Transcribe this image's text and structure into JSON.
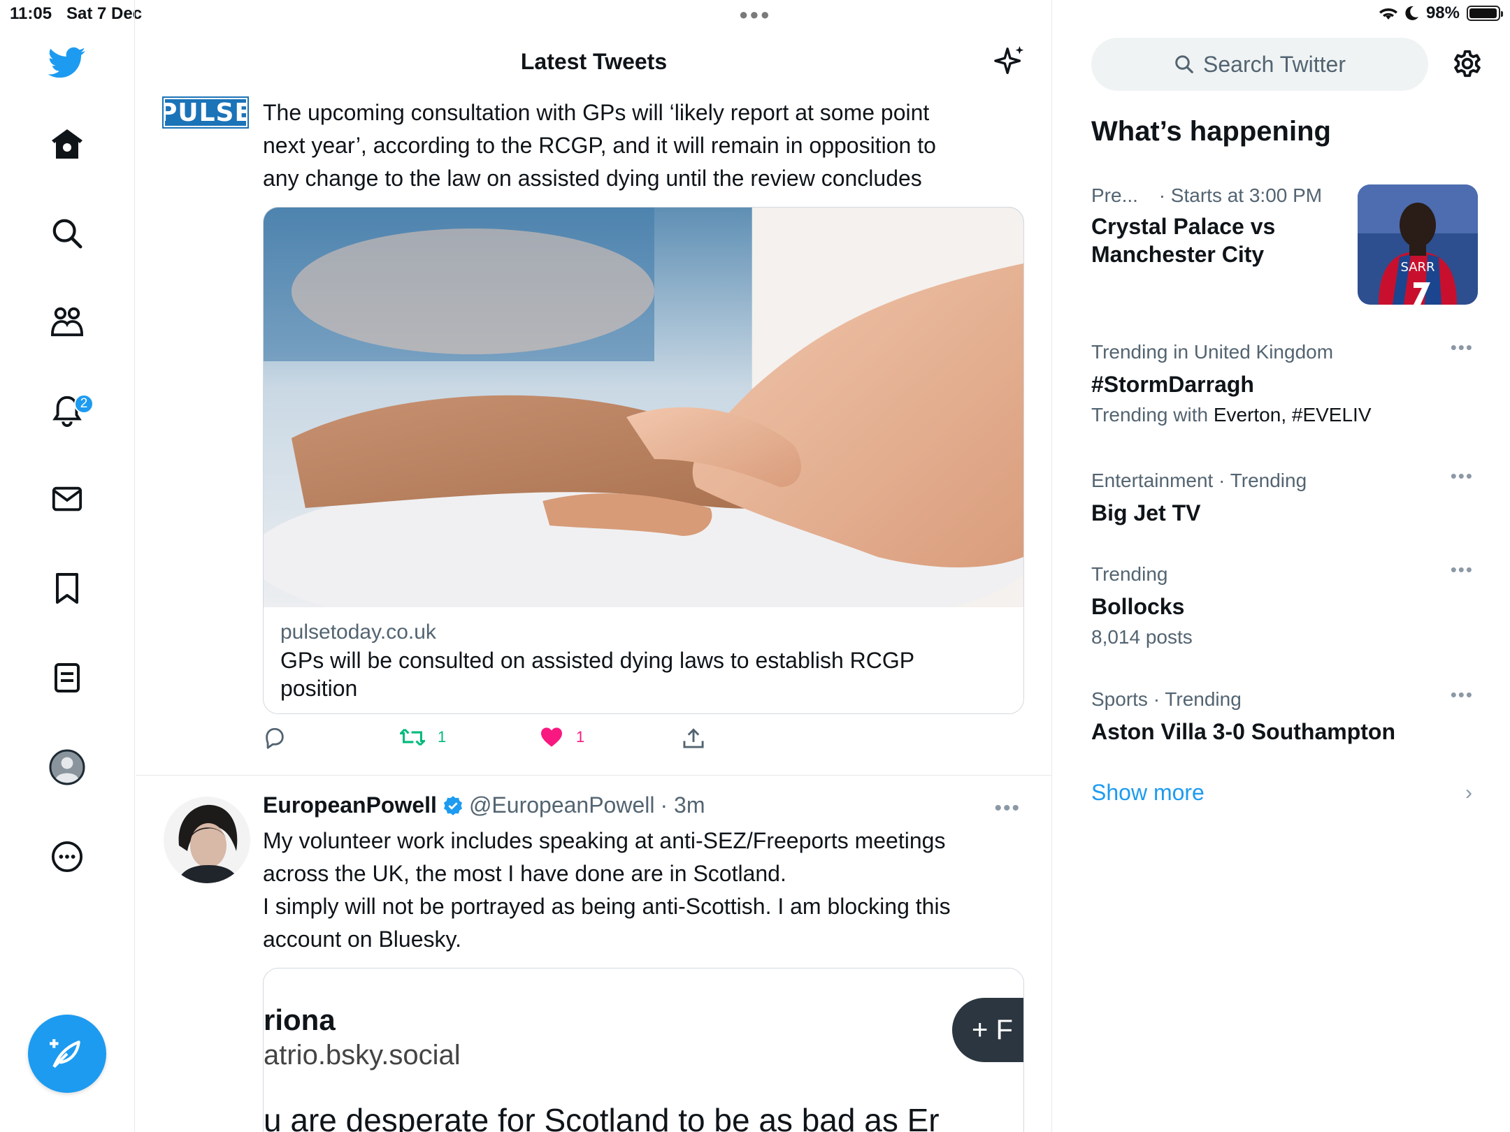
{
  "status_bar": {
    "time": "11:05",
    "date": "Sat 7 Dec",
    "battery": "98%",
    "battery_level": 0.98
  },
  "nav": {
    "notifications_badge": "2"
  },
  "timeline": {
    "title": "Latest Tweets"
  },
  "tweet1": {
    "avatar_text": "PULSE",
    "lines": [
      "The upcoming consultation with GPs will ‘likely report at some point",
      "next year’, according to the RCGP, and it will remain in opposition to",
      "any change to the law on assisted dying until the review concludes"
    ],
    "card_domain": "pulsetoday.co.uk",
    "card_title_lines": [
      "GPs will be consulted on assisted dying laws to establish RCGP",
      "position"
    ],
    "retweets": "1",
    "likes": "1"
  },
  "tweet2": {
    "name": "EuropeanPowell",
    "handle": "@EuropeanPowell",
    "time": "· 3m",
    "more": "•••",
    "lines": [
      "My volunteer work includes speaking at anti-SEZ/Freeports meetings",
      "across the UK, the most I have done are in Scotland.",
      "I simply will not be portrayed as being anti-Scottish. I am blocking this",
      "account on Bluesky."
    ],
    "quote": {
      "name": "riona",
      "handle": "atrio.bsky.social",
      "follow": "+ F",
      "text": "u are desperate for Scotland to be as bad as Er"
    }
  },
  "sidebar": {
    "search_placeholder": "Search Twitter",
    "heading": "What’s happening",
    "event": {
      "meta_left": "Pre...",
      "meta_right": "· Starts at 3:00 PM",
      "title_lines": [
        "Crystal Palace vs",
        "Manchester City"
      ],
      "image_label": "SARR"
    },
    "trends": [
      {
        "meta": "Trending in United Kingdom",
        "title": "#StormDarragh",
        "sub_prefix": "Trending with ",
        "sub_value": "Everton, #EVELIV"
      },
      {
        "meta": "Entertainment · Trending",
        "title": "Big Jet TV"
      },
      {
        "meta": "Trending",
        "title": "Bollocks",
        "sub_prefix": "8,014 posts"
      },
      {
        "meta": "Sports · Trending",
        "title": "Aston Villa 3-0 Southampton"
      }
    ],
    "more_dots": "•••",
    "show_more": "Show more",
    "chevron": "›"
  },
  "colors": {
    "accent": "#1d9bf0",
    "retweet": "#00ba7c",
    "like": "#f91880",
    "text": "#0f1419",
    "muted": "#536471"
  }
}
